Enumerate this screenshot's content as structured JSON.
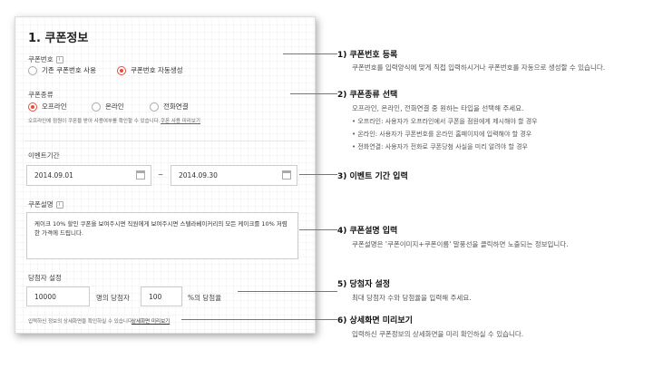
{
  "form": {
    "title": "1. 쿠폰정보",
    "coupon_number": {
      "label": "쿠폰번호",
      "options": [
        "기존 쿠폰번호 사용",
        "쿠폰번호 자동생성"
      ]
    },
    "coupon_type": {
      "label": "쿠폰종류",
      "options": [
        "오프라인",
        "온라인",
        "전화연결"
      ],
      "hint": "오프라인에 점원이 쿠폰을 받아 사용여부를 확인할 수 있습니다.",
      "hint_link": "쿠폰 사용 미리보기"
    },
    "event_period": {
      "label": "이벤트기간",
      "start": "2014.09.01",
      "separator": "~",
      "end": "2014.09.30"
    },
    "description": {
      "label": "쿠폰설명",
      "text": "케이크 10% 할인 쿠폰을 보여주시면 직원에게 보여주시면 스텔라베이커리의 모든 케이크를 10% 저렴한 가격에 드립니다."
    },
    "winners": {
      "label": "당첨자 설정",
      "count": "10000",
      "count_unit": "명의 당첨자",
      "rate": "100",
      "rate_unit": "%의 당첨율"
    },
    "preview": {
      "hint": "입력하신 정보의 상세화면을 확인하실 수 있습니다.",
      "link": "상세화면 미리보기"
    }
  },
  "annotations": [
    {
      "title": "1) 쿠폰번호 등록",
      "desc": "쿠폰번호를 입력양식에 맞게 직접 입력하시거나 쿠폰번호를 자동으로 생성할 수 있습니다."
    },
    {
      "title": "2)  쿠폰종류 선택",
      "desc": "오프라인, 온라인, 전화연결 중 원하는 타입을 선택해 주세요.",
      "bullets": [
        "• 오프라인: 사용자가 오프라인에서 쿠폰을 점원에게 제시해야 할 경우",
        "• 온라인: 사용자가 쿠폰번호를 온라인 홈페이지에 입력해야 할 경우",
        "• 전화연결:  사용자가 전화로 쿠폰당첨 사실을 미리 알려야 할 경우"
      ]
    },
    {
      "title": "3) 이벤트 기간 입력"
    },
    {
      "title": "4) 쿠폰설명 입력",
      "desc": "쿠폰설명은 '쿠폰이미지+쿠폰이름' 말풍선을 클릭하면 노출되는 정보입니다."
    },
    {
      "title": "5)  당첨자 설정",
      "desc": "최대 당첨자 수와 당첨율을 입력해 주세요."
    },
    {
      "title": "6) 상세화면 미리보기",
      "desc": "입력하신 쿠폰정보의 상세화면을 미리 확인하실 수 있습니다."
    }
  ],
  "colors": {
    "accent": "#e74c3c",
    "border": "#cccccc"
  }
}
